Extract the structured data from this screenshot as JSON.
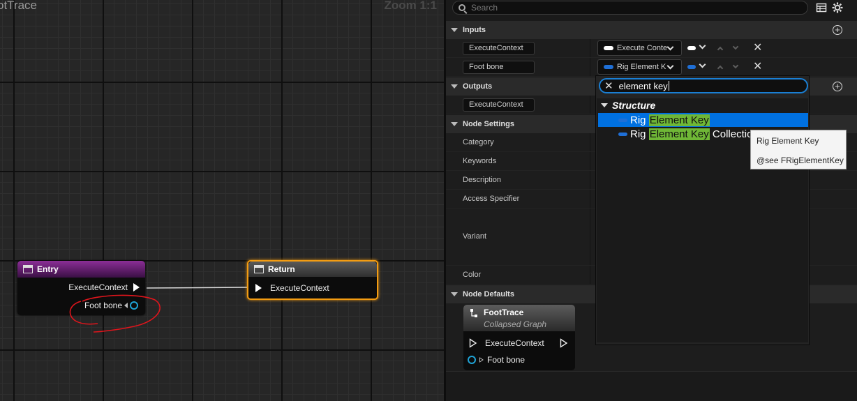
{
  "graph": {
    "title": "otTrace",
    "zoom": "Zoom 1:1",
    "entry_node": {
      "title": "Entry",
      "exec_pin": "ExecuteContext",
      "bone_pin": "Foot bone"
    },
    "return_node": {
      "title": "Return",
      "exec_pin": "ExecuteContext"
    }
  },
  "panel": {
    "search_placeholder": "Search",
    "sections": {
      "inputs": "Inputs",
      "outputs": "Outputs",
      "node_settings": "Node Settings",
      "node_defaults": "Node Defaults"
    },
    "inputs": [
      {
        "name": "ExecuteContext",
        "type": "Execute Conte",
        "pill_color": "#ffffff"
      },
      {
        "name": "Foot bone",
        "type": "Rig Element K",
        "pill_color": "#1f6fd6"
      }
    ],
    "outputs": [
      {
        "name": "ExecuteContext"
      }
    ],
    "node_settings": [
      "Category",
      "Keywords",
      "Description",
      "Access Specifier",
      "Variant",
      "Color"
    ],
    "preview_node": {
      "title": "FootTrace",
      "subtitle": "Collapsed Graph",
      "exec_pin": "ExecuteContext",
      "bone_pin": "Foot bone"
    }
  },
  "popup": {
    "search_value": "element key",
    "category": "Structure",
    "options": [
      {
        "pre": "Rig ",
        "match": "Element Key",
        "post": "",
        "selected": true
      },
      {
        "pre": "Rig ",
        "match": "Element Key",
        "post": " Collection",
        "selected": false
      }
    ]
  },
  "tooltip": {
    "line1": "Rig Element Key",
    "line2": "@see FRigElementKey"
  },
  "colors": {
    "accent_blue": "#0070e0",
    "highlight_green": "#6fb736",
    "entry_purple": "#8b2e96",
    "return_orange": "#f39c12",
    "annotation_red": "#e0151c"
  }
}
